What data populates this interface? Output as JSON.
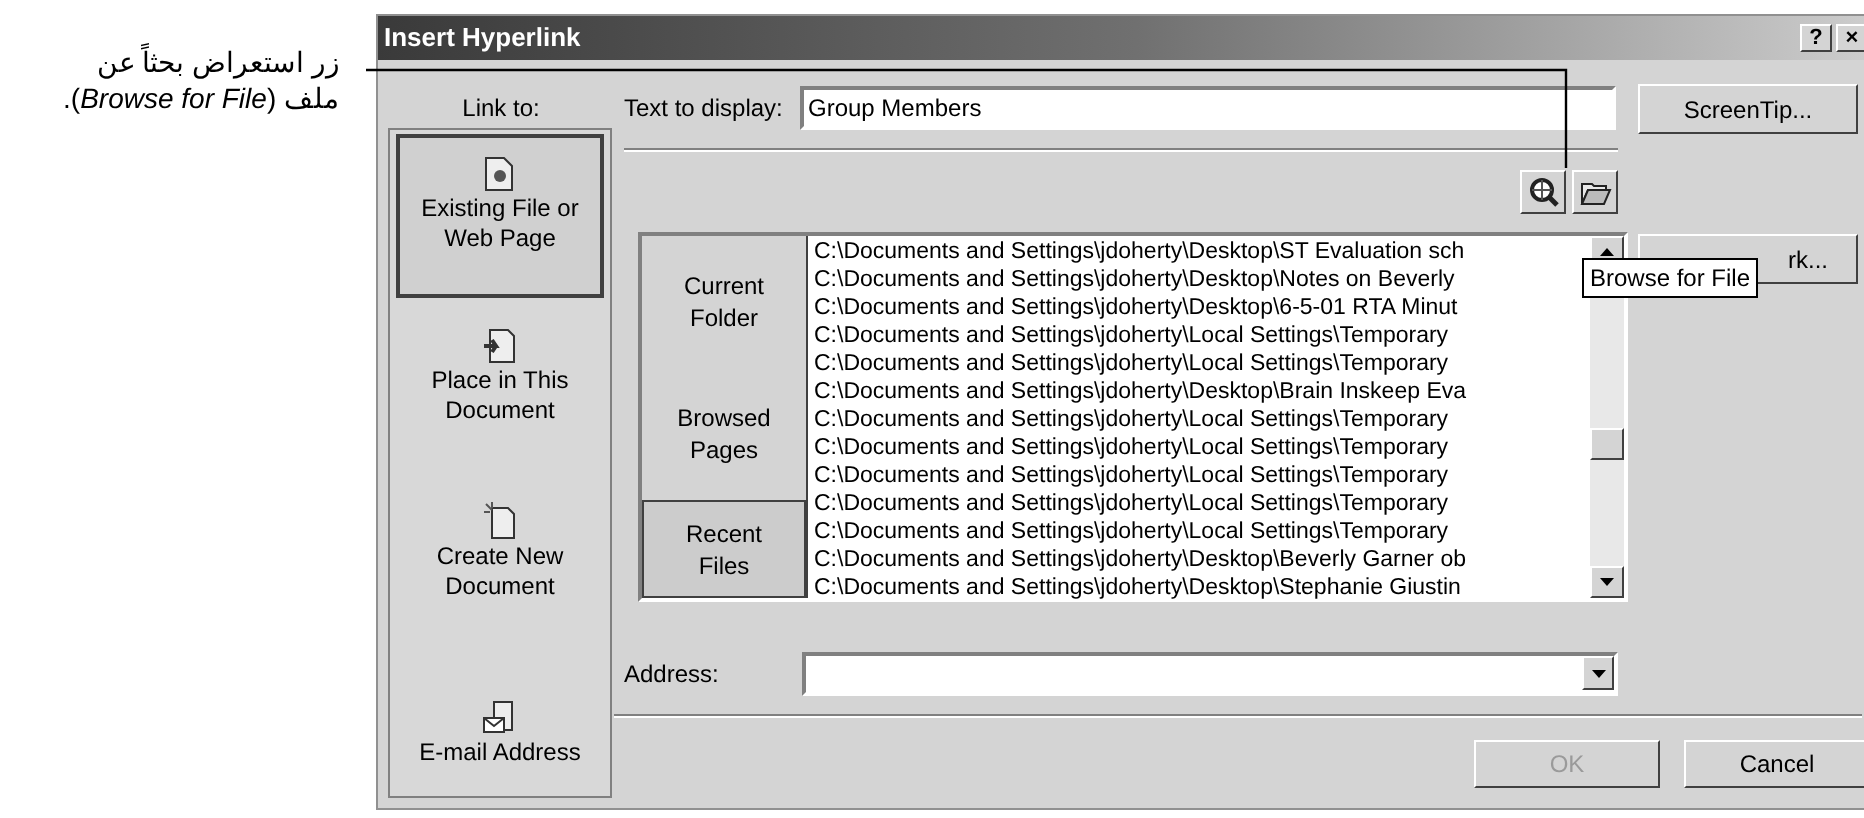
{
  "callout": {
    "text": "زر استعراض بحثاً عن ملف (*Browse for File*)."
  },
  "window": {
    "title": "Insert Hyperlink",
    "title_buttons": [
      "?",
      "×"
    ]
  },
  "link_to": {
    "label": "Link to:",
    "items": [
      {
        "kind": "existing",
        "label": "Existing File or Web Page",
        "selected": true
      },
      {
        "kind": "place",
        "label": "Place in This Document",
        "selected": false
      },
      {
        "kind": "new",
        "label": "Create New Document",
        "selected": false
      },
      {
        "kind": "email",
        "label": "E-mail Address",
        "selected": false
      }
    ]
  },
  "text_to_display": {
    "label": "Text to display:",
    "value": "Group Members"
  },
  "screentip_button": "ScreenTip...",
  "bookmark_button": "rk...",
  "tooltip": "Browse for File",
  "look_in_tabs": [
    {
      "label": "Current Folder",
      "selected": false
    },
    {
      "label": "Browsed Pages",
      "selected": false
    },
    {
      "label": "Recent Files",
      "selected": true
    }
  ],
  "files": [
    "C:\\Documents and Settings\\jdoherty\\Desktop\\ST Evaluation sch",
    "C:\\Documents and Settings\\jdoherty\\Desktop\\Notes on Beverly",
    "C:\\Documents and Settings\\jdoherty\\Desktop\\6-5-01 RTA Minut",
    "C:\\Documents and Settings\\jdoherty\\Local Settings\\Temporary",
    "C:\\Documents and Settings\\jdoherty\\Local Settings\\Temporary",
    "C:\\Documents and Settings\\jdoherty\\Desktop\\Brain Inskeep Eva",
    "C:\\Documents and Settings\\jdoherty\\Local Settings\\Temporary",
    "C:\\Documents and Settings\\jdoherty\\Local Settings\\Temporary",
    "C:\\Documents and Settings\\jdoherty\\Local Settings\\Temporary",
    "C:\\Documents and Settings\\jdoherty\\Local Settings\\Temporary",
    "C:\\Documents and Settings\\jdoherty\\Local Settings\\Temporary",
    "C:\\Documents and Settings\\jdoherty\\Desktop\\Beverly Garner ob",
    "C:\\Documents and Settings\\jdoherty\\Desktop\\Stephanie Giustin"
  ],
  "address": {
    "label": "Address:"
  },
  "buttons": [
    {
      "label": "OK",
      "disabled": true
    },
    {
      "label": "Cancel",
      "disabled": false
    }
  ]
}
